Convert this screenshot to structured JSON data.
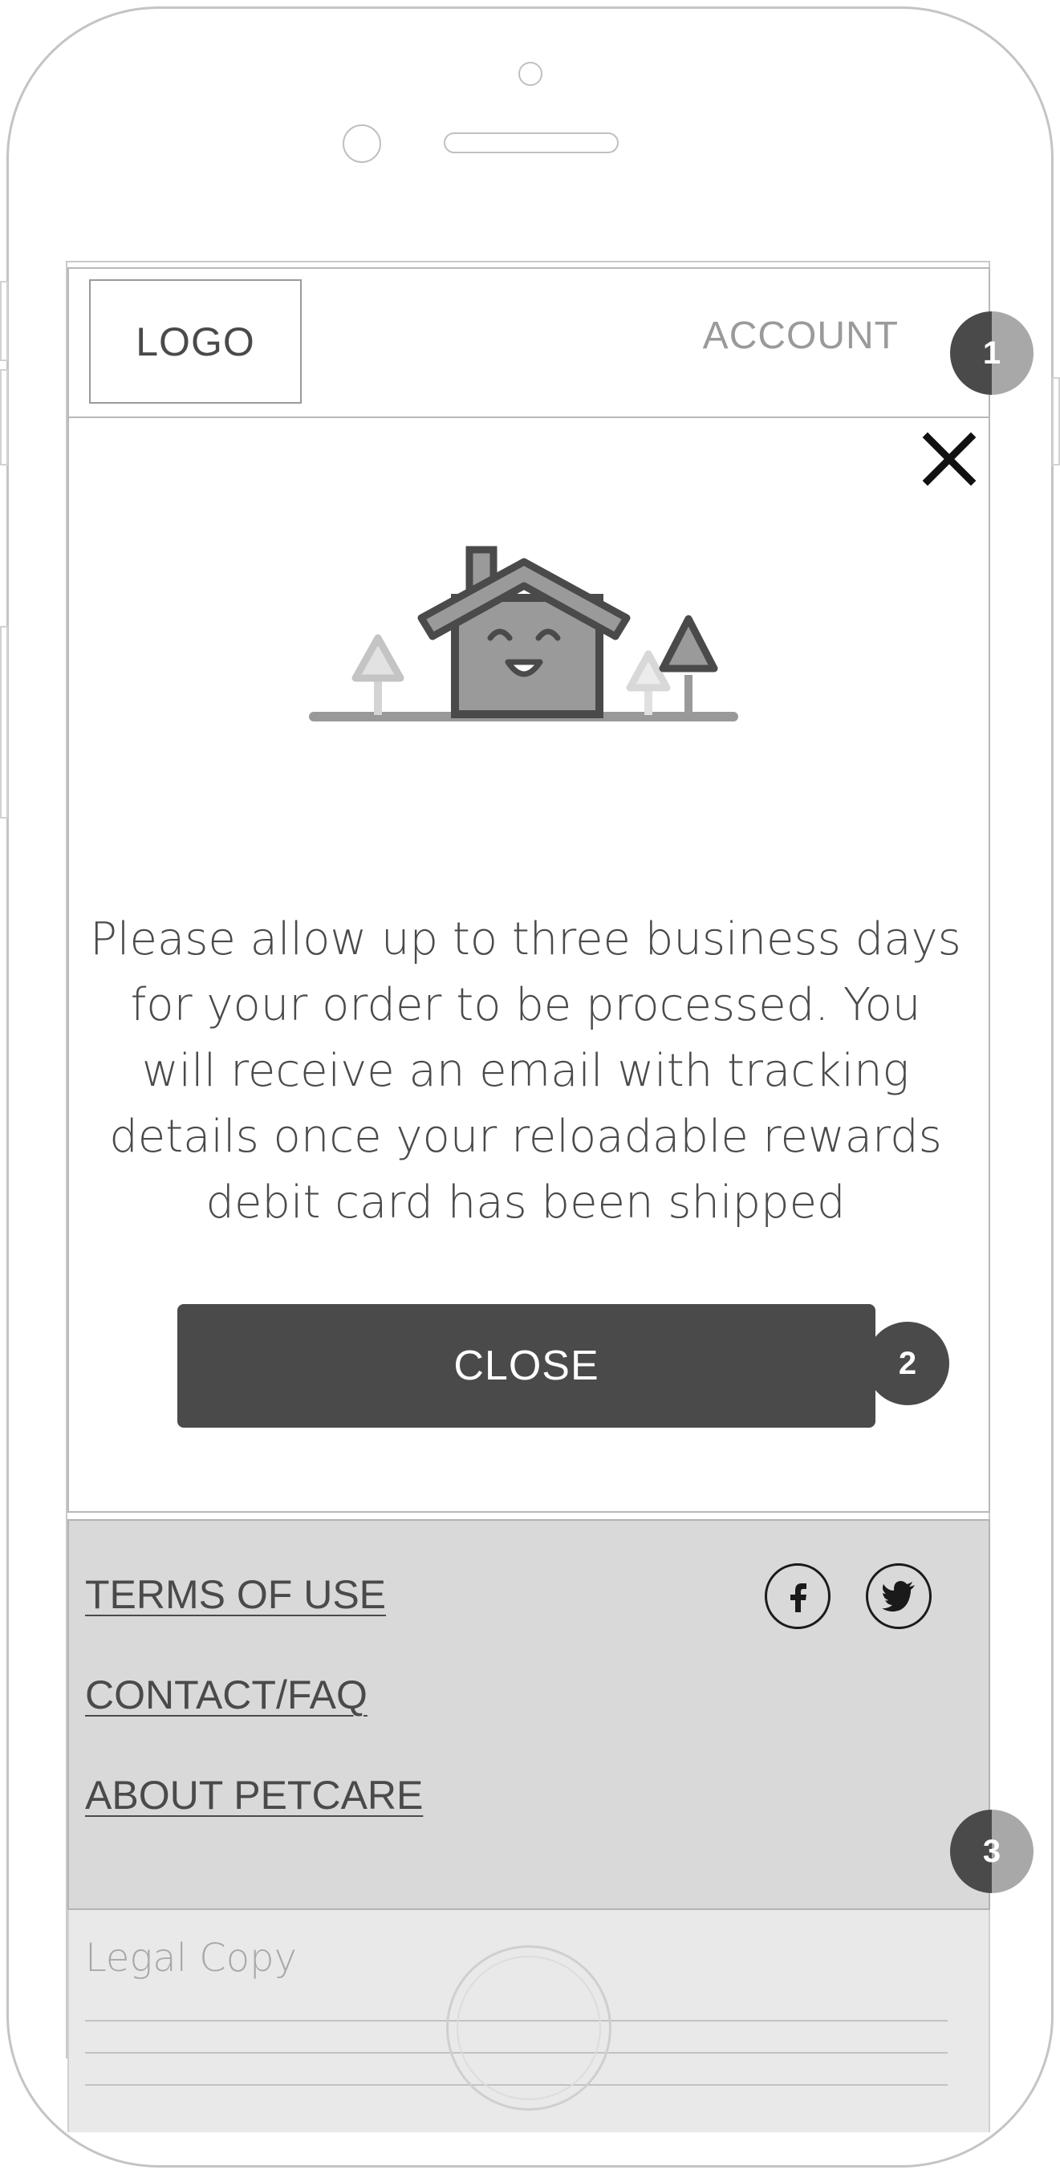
{
  "header": {
    "logo_label": "LOGO",
    "account_label": "ACCOUNT"
  },
  "modal": {
    "message": "Please allow up to three business days for your order to be processed. You will receive an email with tracking details once your reloadable rewards debit card has been shipped",
    "close_label": "CLOSE",
    "close_icon": "close-x-icon",
    "illustration_icon": "smiling-house-icon"
  },
  "footer": {
    "links": [
      "TERMS OF USE",
      "CONTACT/FAQ",
      "ABOUT PETCARE"
    ],
    "social_icons": [
      "facebook-icon",
      "twitter-icon"
    ]
  },
  "legal": {
    "title": "Legal Copy"
  },
  "annotations": [
    "1",
    "2",
    "3"
  ],
  "colors": {
    "primary_dark": "#4a4a4a",
    "footer_bg": "#d9d9d9",
    "legal_bg": "#e9e9e9",
    "muted_text": "#9a9a9a"
  }
}
